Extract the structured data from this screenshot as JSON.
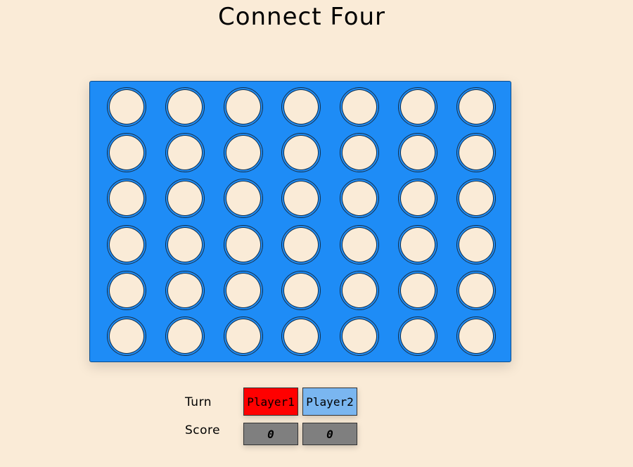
{
  "title": "Connect Four",
  "board": {
    "rows": 6,
    "columns": 7,
    "cells": [
      [
        "",
        "",
        "",
        "",
        "",
        "",
        ""
      ],
      [
        "",
        "",
        "",
        "",
        "",
        "",
        ""
      ],
      [
        "",
        "",
        "",
        "",
        "",
        "",
        ""
      ],
      [
        "",
        "",
        "",
        "",
        "",
        "",
        ""
      ],
      [
        "",
        "",
        "",
        "",
        "",
        "",
        ""
      ],
      [
        "",
        "",
        "",
        "",
        "",
        "",
        ""
      ]
    ]
  },
  "turn": {
    "label": "Turn",
    "player1": "Player1",
    "player2": "Player2",
    "active": "player1"
  },
  "score": {
    "label": "Score",
    "player1": "0",
    "player2": "0"
  },
  "colors": {
    "background": "#faebd7",
    "board": "#1e8cf6",
    "player1": "#ff0000",
    "player2": "#7ab6f0",
    "score_box": "#7f7f7f"
  }
}
